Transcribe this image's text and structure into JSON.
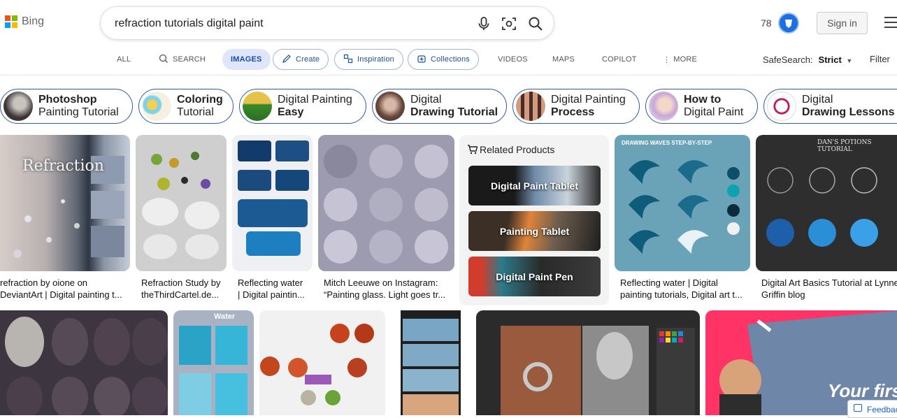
{
  "header": {
    "brand": "Bing",
    "search_value": "refraction tutorials digital paint",
    "reward_points": "78",
    "signin_label": "Sign in"
  },
  "nav": {
    "all": "ALL",
    "search": "SEARCH",
    "images": "IMAGES",
    "create": "Create",
    "inspiration": "Inspiration",
    "collections": "Collections",
    "videos": "VIDEOS",
    "maps": "MAPS",
    "copilot": "COPILOT",
    "more": "MORE",
    "safesearch_label": "SafeSearch:",
    "safesearch_value": "Strict",
    "filter_label": "Filter"
  },
  "chips": [
    {
      "line1": "Photoshop",
      "line2": "Painting Tutorial"
    },
    {
      "line1": "Coloring",
      "line2": "Tutorial"
    },
    {
      "line1": "Digital Painting",
      "line2": "Easy"
    },
    {
      "line1": "Digital",
      "line2": "Drawing Tutorial"
    },
    {
      "line1": "Digital Painting",
      "line2": "Process"
    },
    {
      "line1": "How to",
      "line2": "Digital Paint"
    },
    {
      "line1": "Digital",
      "line2": "Drawing Lessons"
    }
  ],
  "results_row1": [
    {
      "caption1": "refraction by oione on",
      "caption2": "DeviantArt | Digital painting t...",
      "overlay": "Refraction"
    },
    {
      "caption1": "Refraction Study by",
      "caption2": "theThirdCartel.de..."
    },
    {
      "caption1": "Reflecting water",
      "caption2": "| Digital paintin..."
    },
    {
      "caption1": "Mitch Leeuwe on Instagram:",
      "caption2": "“Painting glass. Light goes tr..."
    },
    {
      "caption1": "Reflecting water | Digital",
      "caption2": "painting tutorials, Digital art t...",
      "overlay": "DRAWING WAVES STEP-BY-STEP"
    },
    {
      "caption1": "Digital Art Basics Tutorial at Lynne",
      "caption2": "Griffin blog",
      "overlay": "DAN'S POTIONS TUTORIAL"
    }
  ],
  "related_products": {
    "title": "Related Products",
    "items": [
      "Digital Paint Tablet",
      "Painting Tablet",
      "Digital Paint Pen"
    ]
  },
  "row2_overlays": {
    "water": "Water",
    "your_first": "Your first"
  },
  "feedback_label": "Feedback",
  "colors": {
    "accent": "#174ea6",
    "chip_border": "#2d5ca8",
    "images_pill_bg": "#dfe6fb"
  }
}
